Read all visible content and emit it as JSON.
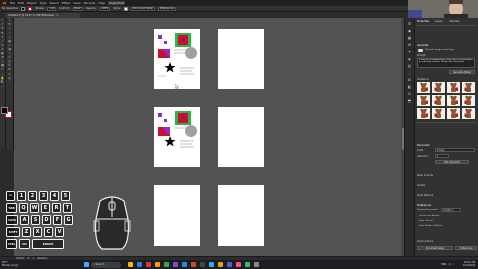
{
  "app": {
    "logo": "Ai",
    "menus": [
      "File",
      "Edit",
      "Object",
      "Type",
      "Select",
      "Effect",
      "View",
      "Window",
      "Help"
    ],
    "workspace_badge": "Essentials"
  },
  "control_bar": {
    "selection_label": "No Selection",
    "stroke_label": "Stroke:",
    "stroke_value": "1 pt",
    "uniform_label": "Uniform",
    "basic_label": "Basic",
    "opacity_label": "Opacity:",
    "opacity_value": "100%",
    "style_label": "Style:",
    "doc_setup": "Document Setup",
    "preferences": "Preferences"
  },
  "document_tab": {
    "title": "Untitled-1* @ 16.67 % (CMYK/Preview)",
    "close": "×"
  },
  "tools": [
    "↖",
    "↗",
    "✎",
    "✒",
    "T",
    "╱",
    "▭",
    "✐",
    "◐",
    "⟲",
    "⤡",
    "▦",
    "✂",
    "⬚",
    "✋",
    "🔍",
    "⋯"
  ],
  "tools2": [
    "⌖",
    "✏",
    "⊹",
    "⌇",
    "◇",
    "▤",
    "⤢",
    "◑",
    "⟟",
    "⬡",
    "◫",
    "⎘",
    "⊕",
    "⊙",
    "◎",
    "⋮"
  ],
  "right_icons": [
    "☰",
    "◆",
    "▦",
    "⚙",
    "✦",
    "◈",
    "▤",
    "⬚",
    "⊞",
    "◧",
    "⊡",
    "⬒"
  ],
  "panel": {
    "tab_properties": "Properties",
    "tab_layers": "Layers",
    "tab_libraries": "Libraries",
    "section_generate": "Generate",
    "generate_hint": "Generate image in new layer",
    "prompt_label": "Prompt",
    "prompt_text": "a realistic anthropomorphic bear with a red backpack as matching stickers, cartoon-like illustration",
    "generate_button": "Generate (Beta)",
    "variations_label": "Variations",
    "document_label": "Document",
    "units_label": "Units",
    "units_value": "Inches",
    "artboard_label": "Artboard",
    "artboard_value": "1",
    "edit_artboards": "Edit Artboards",
    "ruler_label": "Ruler & Grids",
    "guides_label": "Guides",
    "snap_label": "Snap Options",
    "preferences_label": "Preferences",
    "keyboard_increment": "Keyboard Increment",
    "keyboard_increment_value": "0.0139 in",
    "use_preview_bounds": "Use Preview Bounds",
    "scale_corners": "Scale Corners",
    "scale_strokes": "Scale Strokes & Effects",
    "quick_actions": "Quick Actions",
    "doc_setup_button": "Document Setup",
    "preferences_button": "Preferences"
  },
  "status_bar": {
    "zoom": "16.67%",
    "angle": "0°",
    "artboard_nav": "1",
    "tool_name": "Selection"
  },
  "keyboard_overlay": {
    "row1": [
      "~",
      "1",
      "2",
      "3",
      "4",
      "5"
    ],
    "row2_label": "TAB",
    "row2": [
      "Q",
      "W",
      "E",
      "R",
      "T"
    ],
    "row3_label": "CAPS",
    "row3": [
      "A",
      "S",
      "D",
      "F",
      "G"
    ],
    "row4_label": "SHIFT",
    "row4": [
      "Z",
      "X",
      "C",
      "V"
    ],
    "row5": [
      "CTRL",
      "ALT",
      "SPACE"
    ]
  },
  "taskbar": {
    "weather_temp": "65°F",
    "weather_desc": "Mostly cloudy",
    "search_placeholder": "Search",
    "tray_lang": "ENG",
    "clock_time": "10:01 AM",
    "clock_date": "12/1/2023"
  },
  "colors": {
    "fill": "#000000",
    "stroke": "#c8102e",
    "accent_red": "#c8102e",
    "accent_green": "#2db34a",
    "accent_purple": "#8a2be2"
  }
}
